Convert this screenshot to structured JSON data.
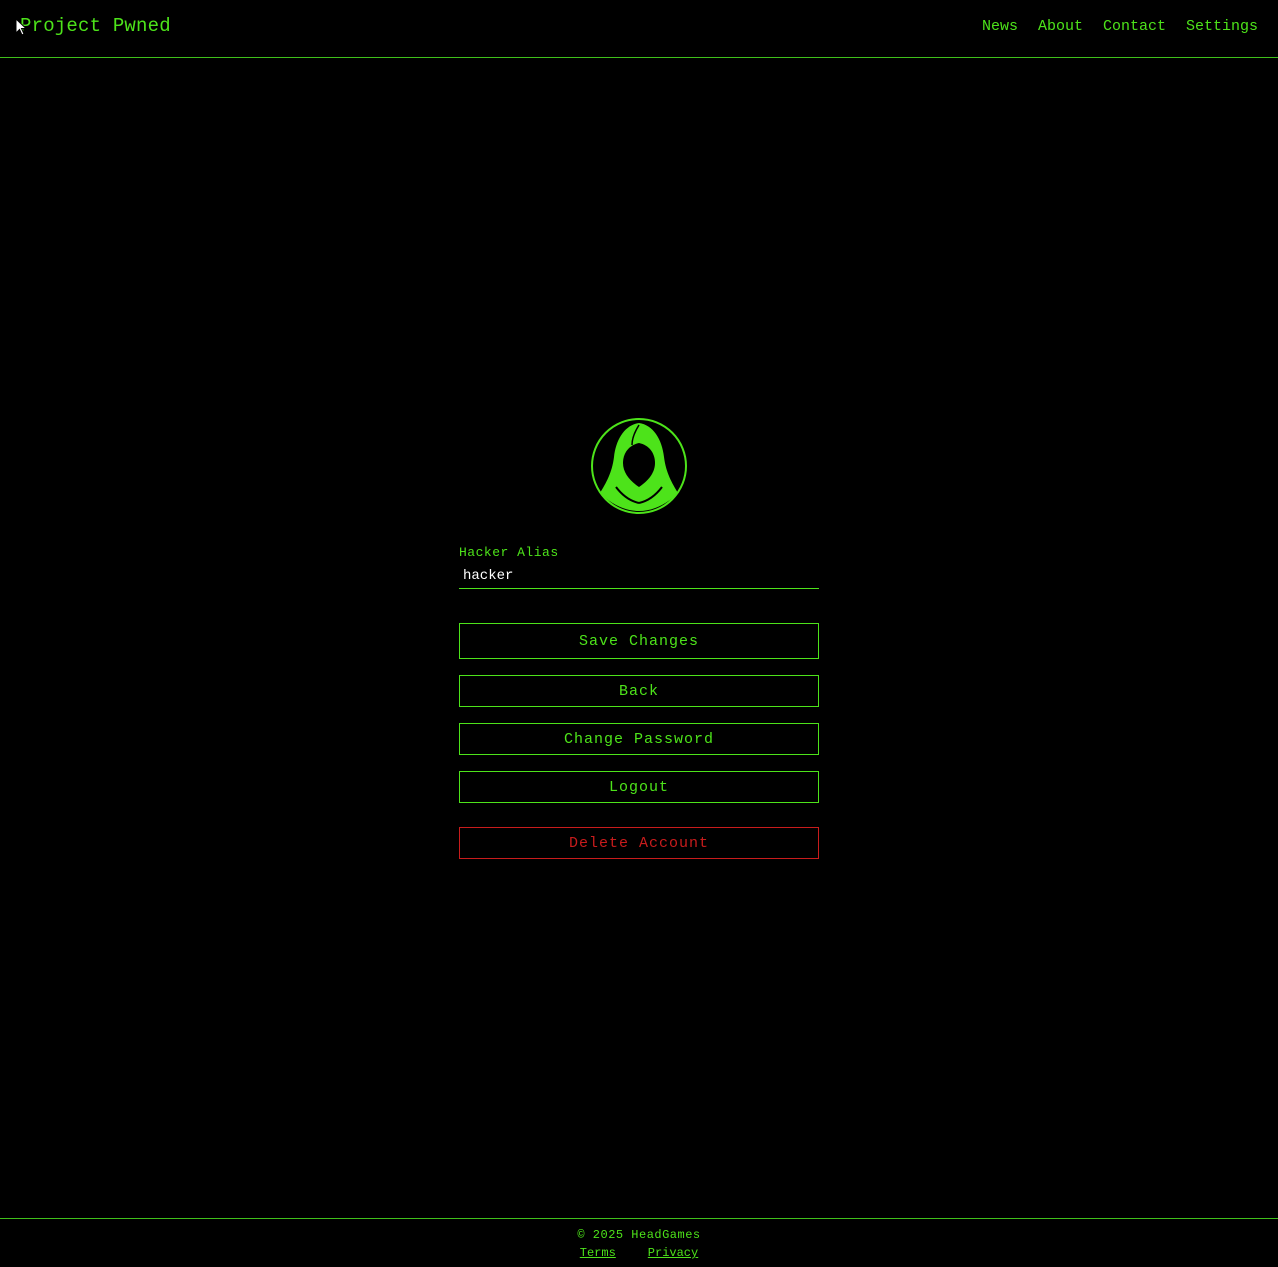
{
  "header": {
    "brand": "Project Pwned",
    "nav": [
      {
        "label": "News"
      },
      {
        "label": "About"
      },
      {
        "label": "Contact"
      },
      {
        "label": "Settings"
      }
    ]
  },
  "profile": {
    "avatar_icon": "hooded-hacker-icon",
    "alias_label": "Hacker Alias",
    "alias_value": "hacker"
  },
  "actions": {
    "save": "Save Changes",
    "back": "Back",
    "change_password": "Change Password",
    "logout": "Logout",
    "delete": "Delete Account"
  },
  "footer": {
    "copyright": "© 2025 HeadGames",
    "terms": "Terms",
    "privacy": "Privacy"
  },
  "colors": {
    "background": "#000000",
    "accent": "#4de31a",
    "danger": "#c81c1c",
    "input_text": "#ffffff"
  }
}
